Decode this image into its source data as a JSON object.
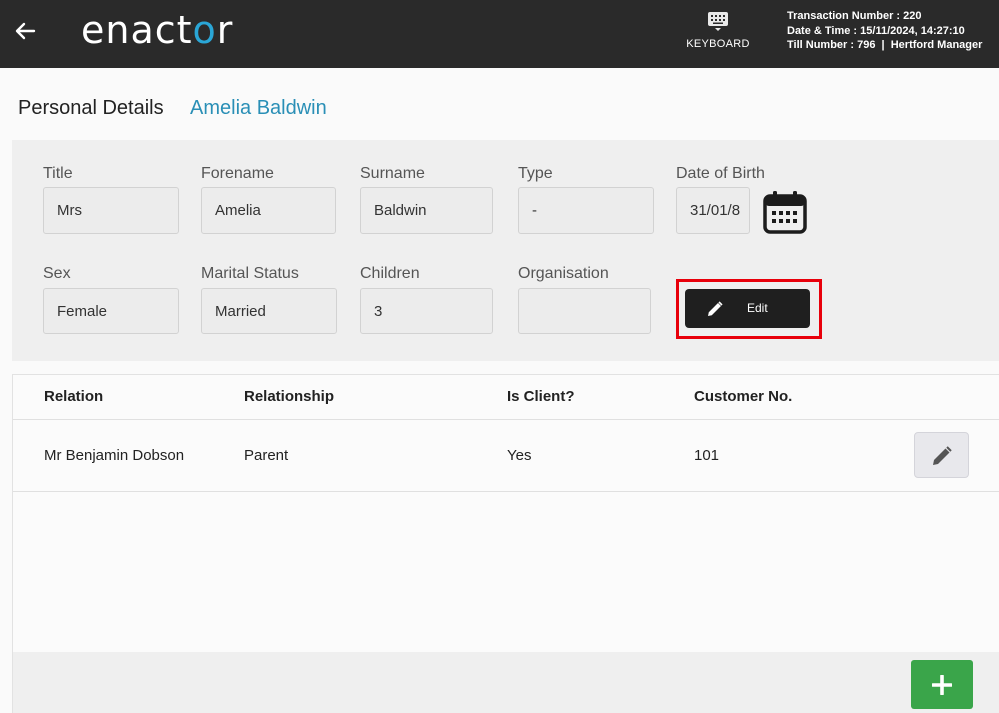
{
  "header": {
    "back_icon": "back-arrow-icon",
    "logo_text_start": "enact",
    "logo_text_accent": "o",
    "logo_text_end": "r",
    "keyboard_label": "KEYBOARD",
    "transaction_number": "Transaction Number : 220",
    "date_time": "Date & Time : 15/11/2024, 14:27:10",
    "till_number": "Till Number : 796  |  Hertford Manager"
  },
  "page": {
    "title": "Personal Details",
    "customer_name": "Amelia Baldwin"
  },
  "form": {
    "title": {
      "label": "Title",
      "value": "Mrs"
    },
    "forename": {
      "label": "Forename",
      "value": "Amelia"
    },
    "surname": {
      "label": "Surname",
      "value": "Baldwin"
    },
    "type": {
      "label": "Type",
      "value": "-"
    },
    "dob": {
      "label": "Date of Birth",
      "value": "31/01/8"
    },
    "sex": {
      "label": "Sex",
      "value": "Female"
    },
    "marital_status": {
      "label": "Marital Status",
      "value": "Married"
    },
    "children": {
      "label": "Children",
      "value": "3"
    },
    "organisation": {
      "label": "Organisation",
      "value": ""
    },
    "edit_label": "Edit"
  },
  "relations": {
    "columns": [
      "Relation",
      "Relationship",
      "Is Client?",
      "Customer No."
    ],
    "rows": [
      {
        "relation": "Mr Benjamin Dobson",
        "relationship": "Parent",
        "is_client": "Yes",
        "customer_no": "101"
      }
    ]
  },
  "colors": {
    "topbar": "#2a2a2a",
    "accent": "#2aa6d6",
    "name_link": "#2a8fb6",
    "highlight": "#e8000b",
    "add_button": "#3aa54a"
  }
}
